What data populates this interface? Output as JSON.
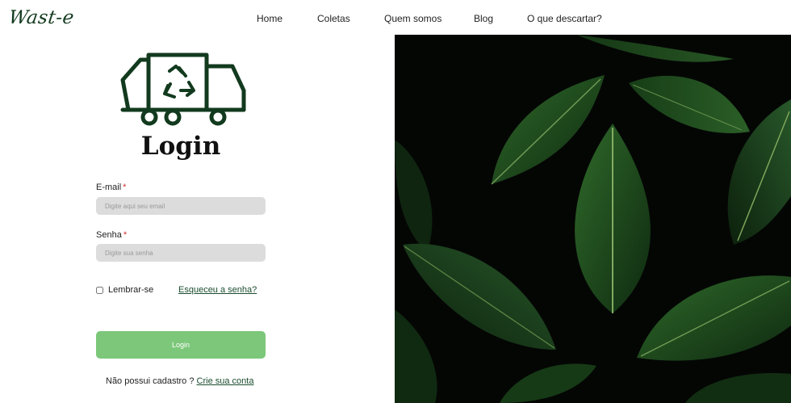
{
  "header": {
    "logo_text": "Wast-e",
    "nav": [
      "Home",
      "Coletas",
      "Quem somos",
      "Blog",
      "O que descartar?"
    ]
  },
  "login": {
    "title": "Login",
    "email_label": "E-mail",
    "email_placeholder": "Digite aqui seu email",
    "password_label": "Senha",
    "password_placeholder": "Digite sua senha",
    "required_marker": "*",
    "remember_label": "Lembrar-se",
    "forgot_link": "Esqueceu a senha?",
    "submit_label": "Login",
    "signup_prompt": "Não possui cadastro ?",
    "signup_link": "Crie sua conta"
  },
  "icons": [
    "recycling-truck-icon"
  ],
  "colors": {
    "brand_green": "#123a1e",
    "button_green": "#7cc779",
    "link_green": "#1a4d2e",
    "required_red": "#d0312d",
    "input_gray": "#dcdcdc"
  }
}
